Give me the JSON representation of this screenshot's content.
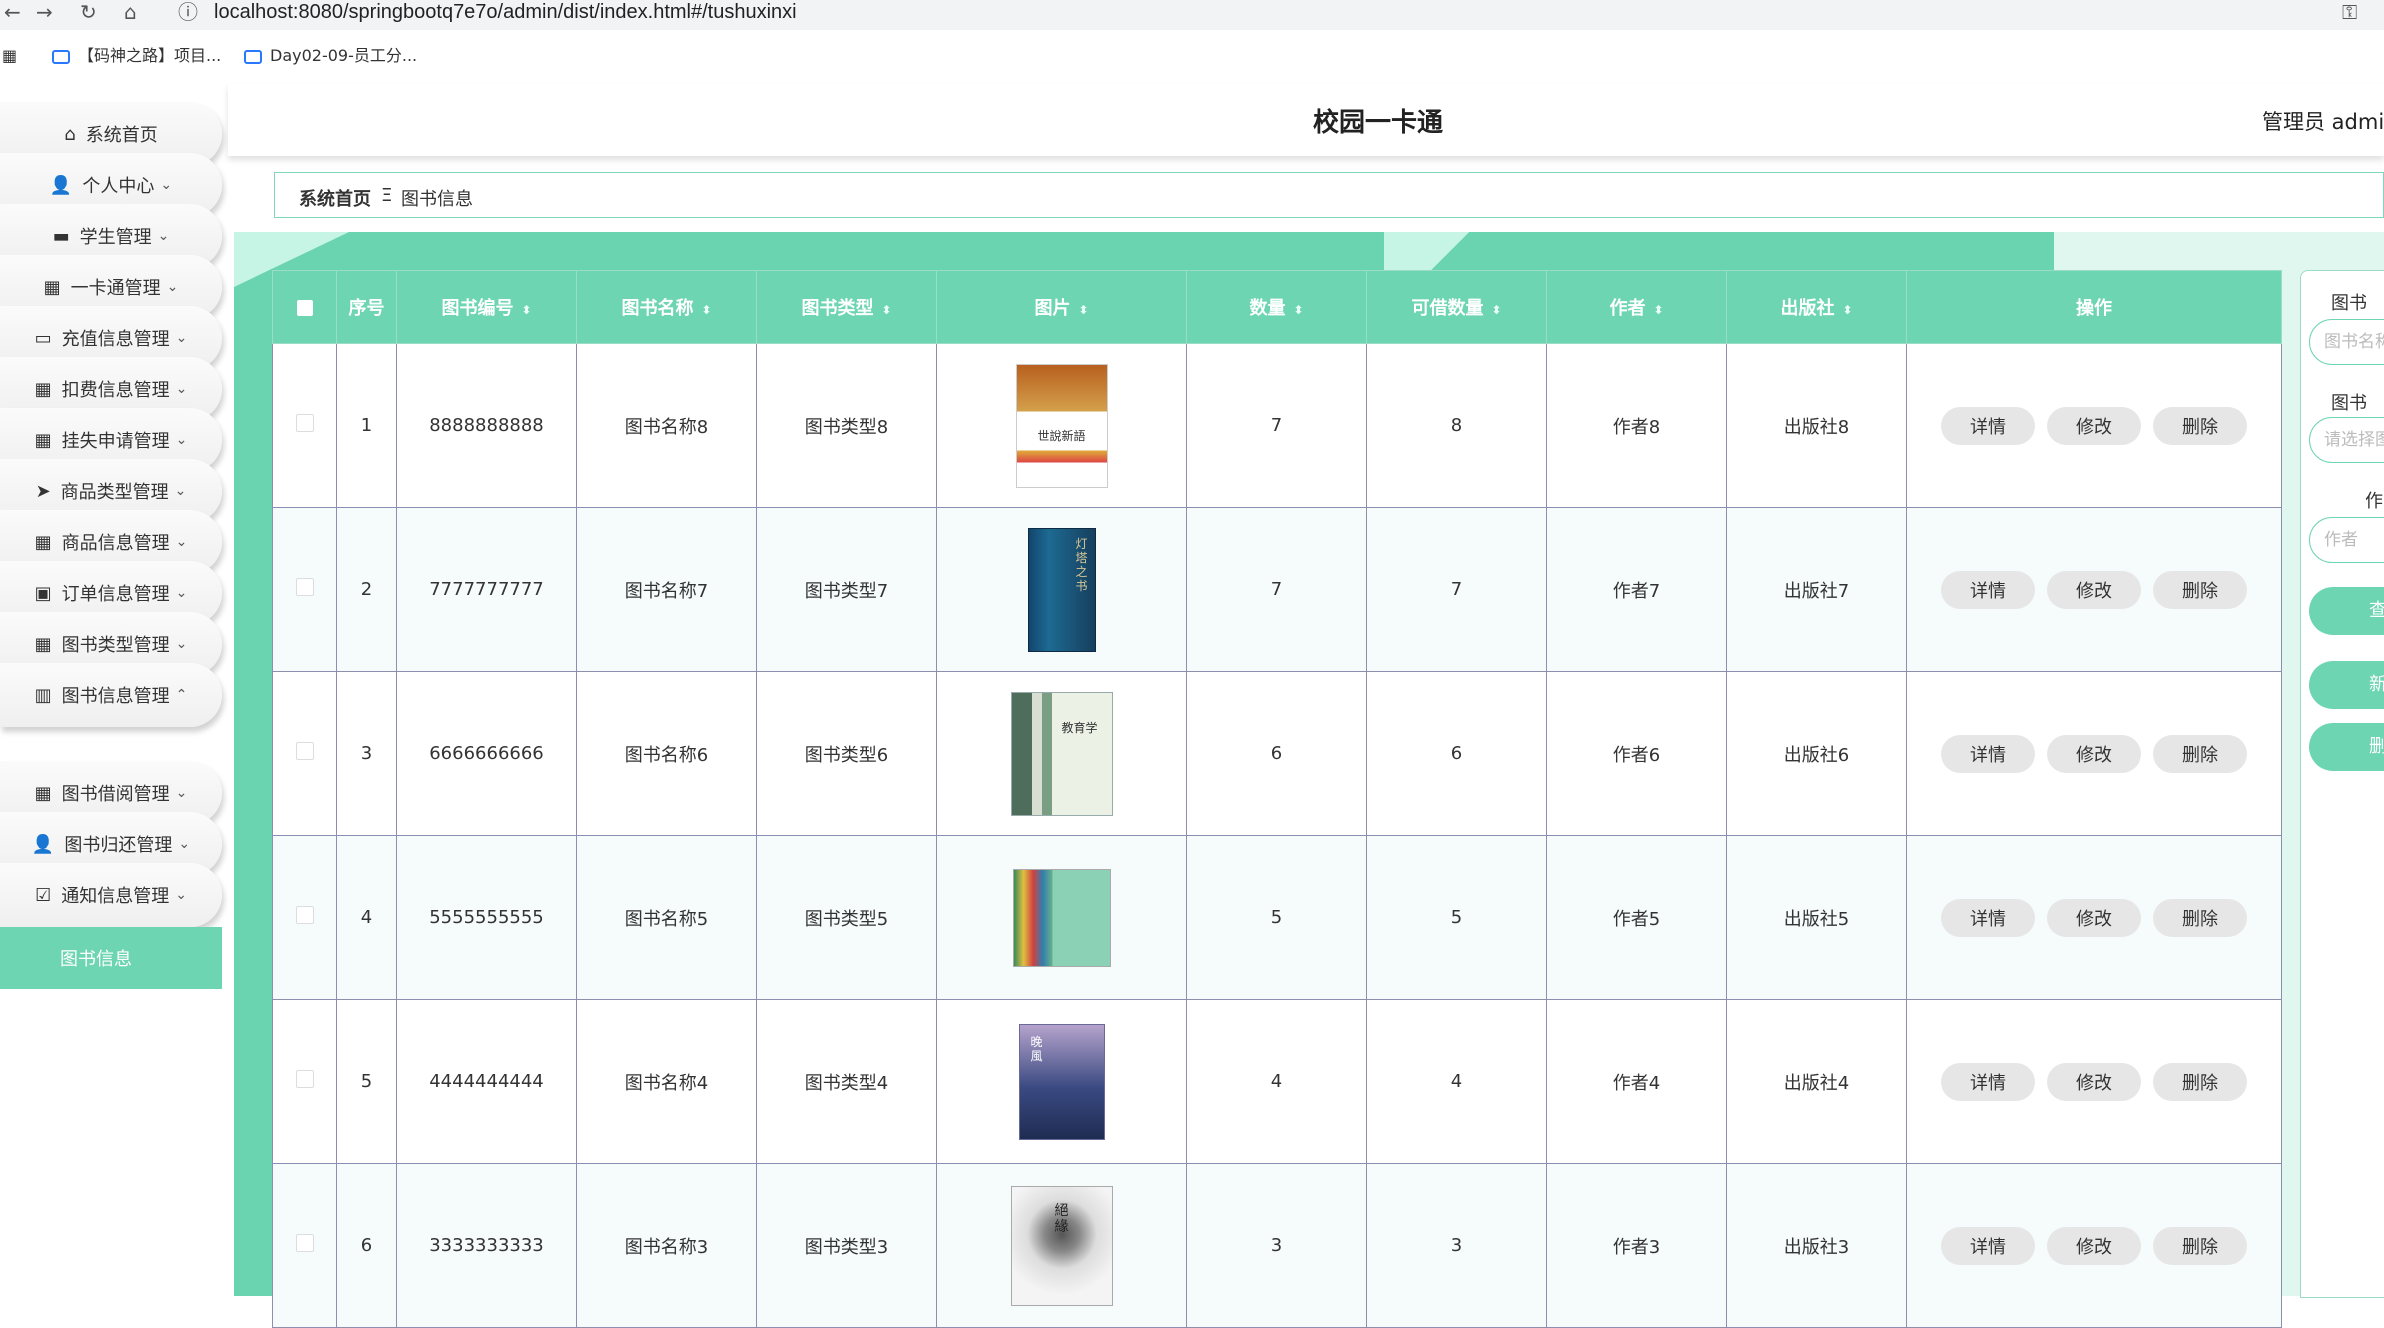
{
  "browser": {
    "url": "localhost:8080/springbootq7e7o/admin/dist/index.html#/tushuxinxi",
    "bookmarks": [
      "【码神之路】项目...",
      "Day02-09-员工分..."
    ]
  },
  "header": {
    "title": "校园一卡通",
    "user": "管理员 admin"
  },
  "sidebar": {
    "items": [
      {
        "label": "系统首页",
        "icon": "home-icon",
        "chevron": false
      },
      {
        "label": "个人中心",
        "icon": "user-icon",
        "chevron": true
      },
      {
        "label": "学生管理",
        "icon": "monitor-icon",
        "chevron": true
      },
      {
        "label": "一卡通管理",
        "icon": "grid-icon",
        "chevron": true
      },
      {
        "label": "充值信息管理",
        "icon": "computer-icon",
        "chevron": true
      },
      {
        "label": "扣费信息管理",
        "icon": "grid-icon",
        "chevron": true
      },
      {
        "label": "挂失申请管理",
        "icon": "grid-icon",
        "chevron": true
      },
      {
        "label": "商品类型管理",
        "icon": "send-icon",
        "chevron": true
      },
      {
        "label": "商品信息管理",
        "icon": "grid-icon",
        "chevron": true
      },
      {
        "label": "订单信息管理",
        "icon": "wallet-icon",
        "chevron": true
      },
      {
        "label": "图书类型管理",
        "icon": "grid-icon",
        "chevron": true
      },
      {
        "label": "图书信息管理",
        "icon": "books-icon",
        "chevron": true,
        "expanded": true
      },
      {
        "label": "图书借阅管理",
        "icon": "grid-icon",
        "chevron": true
      },
      {
        "label": "图书归还管理",
        "icon": "user-icon",
        "chevron": true
      },
      {
        "label": "通知信息管理",
        "icon": "check-icon",
        "chevron": true
      }
    ],
    "active_sub": "图书信息"
  },
  "breadcrumb": {
    "home": "系统首页",
    "separator": "Ξ",
    "current": "图书信息"
  },
  "table": {
    "headers": [
      "序号",
      "图书编号",
      "图书名称",
      "图书类型",
      "图片",
      "数量",
      "可借数量",
      "作者",
      "出版社",
      "操作"
    ],
    "rows": [
      {
        "index": "1",
        "code": "8888888888",
        "name": "图书名称8",
        "type": "图书类型8",
        "qty": "7",
        "avail": "8",
        "author": "作者8",
        "publisher": "出版社8",
        "cover_text": "世說新語"
      },
      {
        "index": "2",
        "code": "7777777777",
        "name": "图书名称7",
        "type": "图书类型7",
        "qty": "7",
        "avail": "7",
        "author": "作者7",
        "publisher": "出版社7",
        "cover_text": "灯塔之书"
      },
      {
        "index": "3",
        "code": "6666666666",
        "name": "图书名称6",
        "type": "图书类型6",
        "qty": "6",
        "avail": "6",
        "author": "作者6",
        "publisher": "出版社6",
        "cover_text": "教育学"
      },
      {
        "index": "4",
        "code": "5555555555",
        "name": "图书名称5",
        "type": "图书类型5",
        "qty": "5",
        "avail": "5",
        "author": "作者5",
        "publisher": "出版社5",
        "cover_text": ""
      },
      {
        "index": "5",
        "code": "4444444444",
        "name": "图书名称4",
        "type": "图书类型4",
        "qty": "4",
        "avail": "4",
        "author": "作者4",
        "publisher": "出版社4",
        "cover_text": "晚風"
      },
      {
        "index": "6",
        "code": "3333333333",
        "name": "图书名称3",
        "type": "图书类型3",
        "qty": "3",
        "avail": "3",
        "author": "作者3",
        "publisher": "出版社3",
        "cover_text": "絕緣"
      }
    ],
    "actions": [
      "详情",
      "修改",
      "删除"
    ]
  },
  "search": {
    "label_name": "图书",
    "placeholder_name": "图书名称",
    "label_type": "图书",
    "placeholder_type": "请选择图",
    "label_author": "作",
    "placeholder_author": "作者",
    "btn_search": "查",
    "btn_add": "新",
    "btn_delete": "删"
  },
  "colors": {
    "accent": "#6dd5b1",
    "accent_pale": "#c6f5e5"
  }
}
